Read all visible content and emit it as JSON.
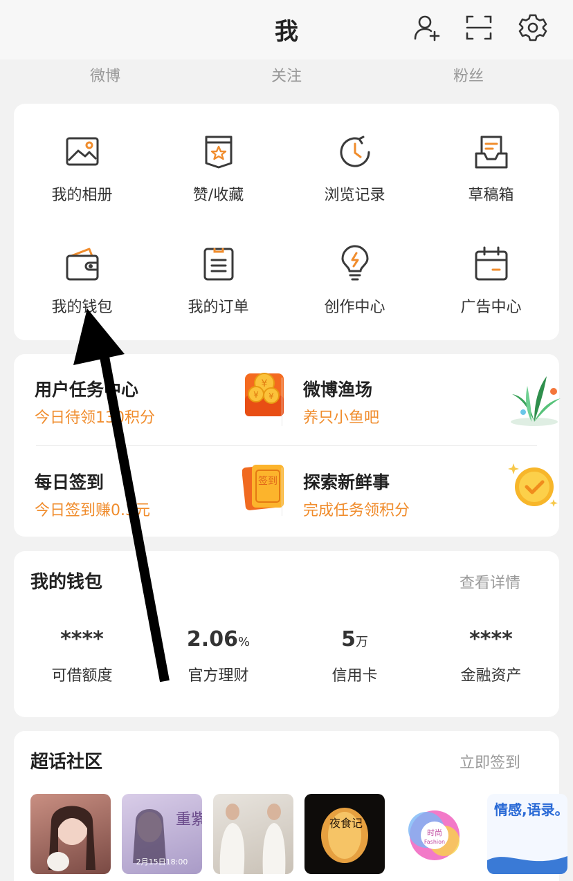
{
  "header": {
    "title": "我",
    "icons": [
      "add-friend-icon",
      "scan-icon",
      "settings-icon"
    ]
  },
  "stats": [
    "微博",
    "关注",
    "粉丝"
  ],
  "grid": [
    {
      "label": "我的相册",
      "icon": "album-icon"
    },
    {
      "label": "赞/收藏",
      "icon": "favorite-icon"
    },
    {
      "label": "浏览记录",
      "icon": "history-icon"
    },
    {
      "label": "草稿箱",
      "icon": "draft-box-icon"
    },
    {
      "label": "我的钱包",
      "icon": "wallet-icon"
    },
    {
      "label": "我的订单",
      "icon": "order-icon"
    },
    {
      "label": "创作中心",
      "icon": "creator-bulb-icon"
    },
    {
      "label": "广告中心",
      "icon": "ad-calendar-icon"
    }
  ],
  "tasks": [
    {
      "title": "用户任务中心",
      "sub": "今日待领130积分",
      "icon": "coin-chest-icon"
    },
    {
      "title": "微博渔场",
      "sub": "养只小鱼吧",
      "icon": "plant-icon"
    },
    {
      "title": "每日签到",
      "sub": "今日签到赚0.3元",
      "icon": "checkin-card-icon",
      "badge": "签到"
    },
    {
      "title": "探索新鲜事",
      "sub": "完成任务领积分",
      "icon": "gold-check-icon"
    }
  ],
  "wallet": {
    "title": "我的钱包",
    "link": "查看详情",
    "items": [
      {
        "value": "****",
        "unit": "",
        "label": "可借额度"
      },
      {
        "value": "2.06",
        "unit": "%",
        "label": "官方理财"
      },
      {
        "value": "5",
        "unit": "万",
        "label": "信用卡"
      },
      {
        "value": "****",
        "unit": "",
        "label": "金融资产"
      }
    ]
  },
  "super_topic": {
    "title": "超话社区",
    "link": "立即签到",
    "thumbs": [
      "portrait-thumb",
      "poster-thumb",
      "body-thumb",
      "lantern-thumb",
      "fashion-thumb",
      "emotion-thumb"
    ],
    "thumb_texts": {
      "poster_title": "重紫",
      "poster_date": "2月15日18:00",
      "lantern": "夜食记",
      "fashion_cn": "时尚",
      "fashion_en": "Fashion",
      "emotion": "情感,语录。"
    }
  },
  "colors": {
    "accent": "#f08c2c",
    "icon": "#3a3a3a"
  }
}
